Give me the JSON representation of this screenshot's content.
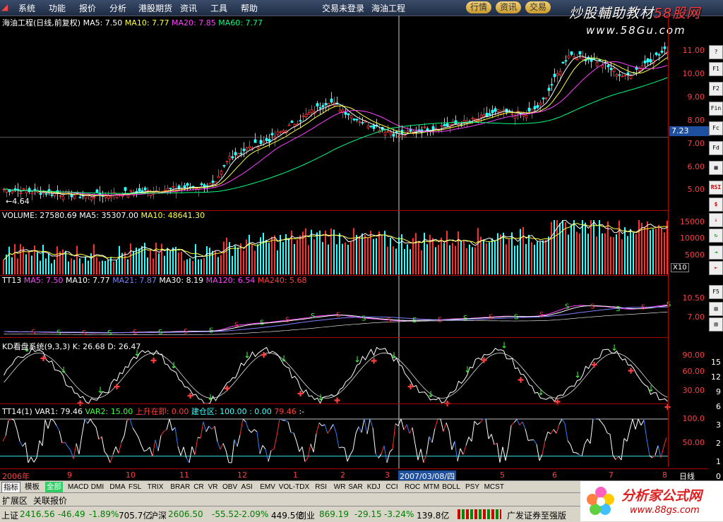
{
  "menu": {
    "items": [
      "系统",
      "功能",
      "报价",
      "分析",
      "港股期货",
      "资讯",
      "工具",
      "帮助"
    ],
    "trade_status": "交易未登录",
    "stock_name": "海油工程",
    "pills": [
      "行情",
      "资讯",
      "交易"
    ]
  },
  "brand": {
    "line1_a": "炒股輔助教材",
    "line1_b": "58股网",
    "line2": "www.58Gu.com"
  },
  "price_panel": {
    "title": "海油工程(日线,前复权)",
    "ma5": "MA5: 7.50",
    "ma10": "MA10: 7.77",
    "ma20": "MA20: 7.85",
    "ma60": "MA60: 7.77",
    "low_marker": "←4.64",
    "price_tag": "7.23",
    "axis": [
      "11.00",
      "10.00",
      "9.00",
      "8.00",
      "7.00",
      "6.00",
      "5.00"
    ],
    "colors": {
      "ma5": "#ffffff",
      "ma10": "#ffff00",
      "ma20": "#ff40ff",
      "ma60": "#00ff80"
    }
  },
  "volume_panel": {
    "title": "VOLUME: 27580.69",
    "ma5": "MA5: 35307.00",
    "ma10": "MA10: 48641.30",
    "axis": [
      "15000",
      "10000",
      "5000"
    ],
    "unit": "X10"
  },
  "tt13_panel": {
    "title": "TT13",
    "ma5": "MA5: 7.50",
    "ma10": "MA10: 7.77",
    "ma21": "MA21: 7.87",
    "ma30": "MA30: 8.19",
    "ma120": "MA120: 6.54",
    "ma240": "MA240: 5.68",
    "axis": [
      "10.50",
      "7.00"
    ]
  },
  "kd_panel": {
    "title": "KD看盘系统(9,3,3)",
    "k": "K: 26.68",
    "d": "D: 26.47",
    "axis": [
      "90.00",
      "60.00",
      "30.00"
    ]
  },
  "tt14_panel": {
    "title": "TT14(1)",
    "var1": "VAR1: 79.46",
    "var2": "VAR2: 15.00",
    "rise": "上升在即: 0.00",
    "build": "建仓区: 100.00",
    "extra": ": 0.00",
    "last": "79.46",
    "dash": ":-",
    "axis": [
      "100.0",
      "50.00"
    ]
  },
  "xaxis": {
    "labels": [
      "2006年",
      "9",
      "10",
      "11",
      "12",
      "1",
      "2",
      "3",
      "2007/03/08/四",
      "5",
      "6",
      "7",
      "8"
    ],
    "period": "日线"
  },
  "right_axis_extra": [
    "15",
    "12",
    "9",
    "6",
    "3",
    "2",
    "1",
    "0"
  ],
  "tabs": [
    "指标",
    "模板",
    "全部"
  ],
  "indicators": [
    "MACD",
    "DMI",
    "DMA",
    "FSL",
    "TRIX",
    "BRAR",
    "CR",
    "VR",
    "OBV",
    "ASI",
    "EMV",
    "VOL-TDX",
    "RSI",
    "WR",
    "SAR",
    "KDJ",
    "CCI",
    "ROC",
    "MTM",
    "BOLL",
    "PSY",
    "MCST"
  ],
  "ext_bar": {
    "label": "扩展区",
    "item": "关联报价"
  },
  "status": {
    "sh_name": "上证",
    "sh_val": "2416.56",
    "sh_chg": "-46.49",
    "sh_pct": "-1.89%",
    "sh_amt": "705.7亿",
    "sz_name": "沪深",
    "sz_val": "2606.50",
    "sz_chg": "-55.52",
    "sz_pct": "-2.09%",
    "sz_amt": "449.5亿",
    "cy_name": "创业",
    "cy_val": "869.19",
    "cy_chg": "-29.15",
    "cy_pct": "-3.24%",
    "cy_amt": "139.8亿",
    "broker": "广发证券至强版"
  },
  "logo2": {
    "text": "分析家公式网",
    "url": "www.88gs.com"
  },
  "tools": [
    "",
    "F1",
    "F2",
    "Fin",
    "Fc",
    "Fd",
    "",
    "RSI",
    "$",
    "",
    "",
    "",
    "",
    "F5",
    "",
    "",
    ""
  ]
}
